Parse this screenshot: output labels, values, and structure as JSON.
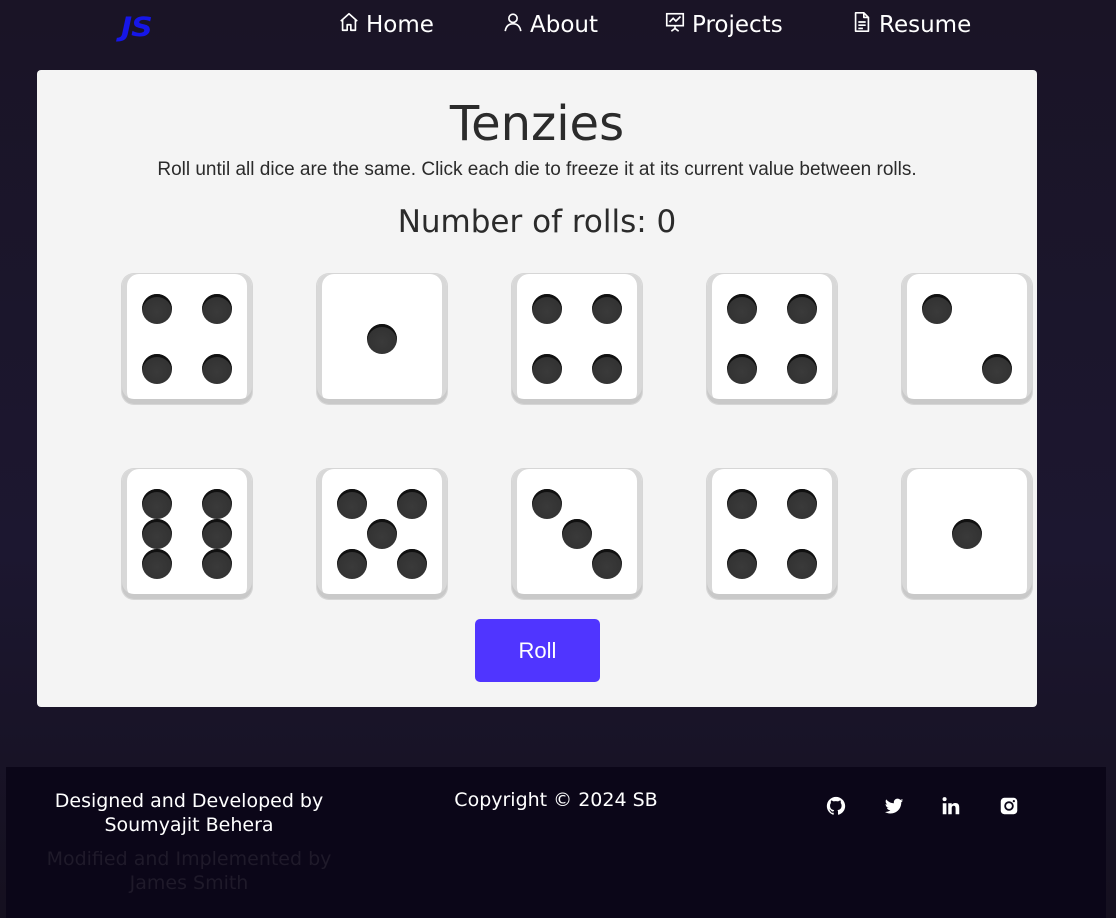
{
  "nav": {
    "logo": "JS",
    "items": [
      {
        "label": "Home",
        "icon": "home-icon"
      },
      {
        "label": "About",
        "icon": "user-icon"
      },
      {
        "label": "Projects",
        "icon": "presentation-icon"
      },
      {
        "label": "Resume",
        "icon": "document-icon"
      }
    ]
  },
  "game": {
    "title": "Tenzies",
    "instructions": "Roll until all dice are the same. Click each die to freeze it at its current value between rolls.",
    "rolls_label": "Number of rolls: 0",
    "dice": [
      4,
      1,
      4,
      4,
      2,
      6,
      5,
      3,
      4,
      1
    ],
    "roll_button": "Roll",
    "accent": "#5035ff"
  },
  "footer": {
    "designed_line1": "Designed and Developed by",
    "designed_line2": "Soumyajit Behera",
    "modified_line1": "Modified and Implemented by",
    "modified_line2": "James Smith",
    "copyright": "Copyright © 2024 SB",
    "social": [
      "github-icon",
      "twitter-icon",
      "linkedin-icon",
      "instagram-icon"
    ]
  }
}
